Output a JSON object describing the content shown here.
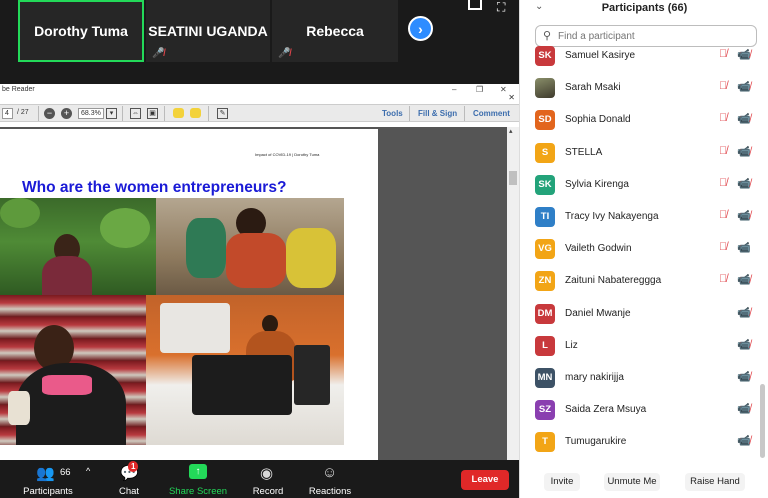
{
  "thumbnails": [
    {
      "name": "Dorothy Tuma",
      "active": true,
      "muted": false
    },
    {
      "name": "SEATINI UGANDA",
      "active": false,
      "muted": true
    },
    {
      "name": "Rebecca",
      "active": false,
      "muted": true
    }
  ],
  "adobe": {
    "window_title": "be Reader",
    "page_current": "4",
    "page_total": "/ 27",
    "zoom": "68.3%",
    "tools_label": "Tools",
    "fill_sign_label": "Fill & Sign",
    "comment_label": "Comment"
  },
  "pdf": {
    "header": "Impact of COVID-19 | Dorothy Tuma",
    "heading": "Who are the women entrepreneurs?"
  },
  "controls": {
    "participants_count": "66",
    "participants_label": "Participants",
    "chat_label": "Chat",
    "chat_badge": "1",
    "share_label": "Share Screen",
    "record_label": "Record",
    "reactions_label": "Reactions",
    "leave_label": "Leave"
  },
  "panel": {
    "title": "Participants (66)",
    "search_placeholder": "Find a participant",
    "participants": [
      {
        "initials": "SK",
        "name": "Samuel Kasirye",
        "color": "#c8393c",
        "mic_muted": true,
        "cam_off": true
      },
      {
        "initials": "",
        "name": "Sarah Msaki",
        "color": "#6b6e5a",
        "mic_muted": true,
        "cam_off": true,
        "photo": true
      },
      {
        "initials": "SD",
        "name": "Sophia Donald",
        "color": "#e2651d",
        "mic_muted": true,
        "cam_off": true
      },
      {
        "initials": "S",
        "name": "STELLA",
        "color": "#f2a516",
        "mic_muted": true,
        "cam_off": true
      },
      {
        "initials": "SK",
        "name": "Sylvia Kirenga",
        "color": "#23a37a",
        "mic_muted": true,
        "cam_off": true
      },
      {
        "initials": "TI",
        "name": "Tracy Ivy Nakayenga",
        "color": "#2f7fc7",
        "mic_muted": true,
        "cam_off": true
      },
      {
        "initials": "VG",
        "name": "Vaileth Godwin",
        "color": "#f2a516",
        "mic_muted": true,
        "cam_off": false
      },
      {
        "initials": "ZN",
        "name": "Zaituni Nabatereggga",
        "color": "#f2a516",
        "mic_muted": true,
        "cam_off": true
      },
      {
        "initials": "DM",
        "name": "Daniel Mwanje",
        "color": "#c8393c",
        "mic_muted": false,
        "cam_off": true
      },
      {
        "initials": "L",
        "name": "Liz",
        "color": "#c8393c",
        "mic_muted": false,
        "cam_off": true
      },
      {
        "initials": "MN",
        "name": "mary nakirijja",
        "color": "#3d5266",
        "mic_muted": false,
        "cam_off": true
      },
      {
        "initials": "SZ",
        "name": "Saida Zera Msuya",
        "color": "#8a3fb0",
        "mic_muted": false,
        "cam_off": true
      },
      {
        "initials": "T",
        "name": "Tumugarukire",
        "color": "#f2a516",
        "mic_muted": false,
        "cam_off": true
      }
    ],
    "invite_label": "Invite",
    "mute_me_label": "Unmute Me",
    "raise_hand_label": "Raise Hand"
  }
}
